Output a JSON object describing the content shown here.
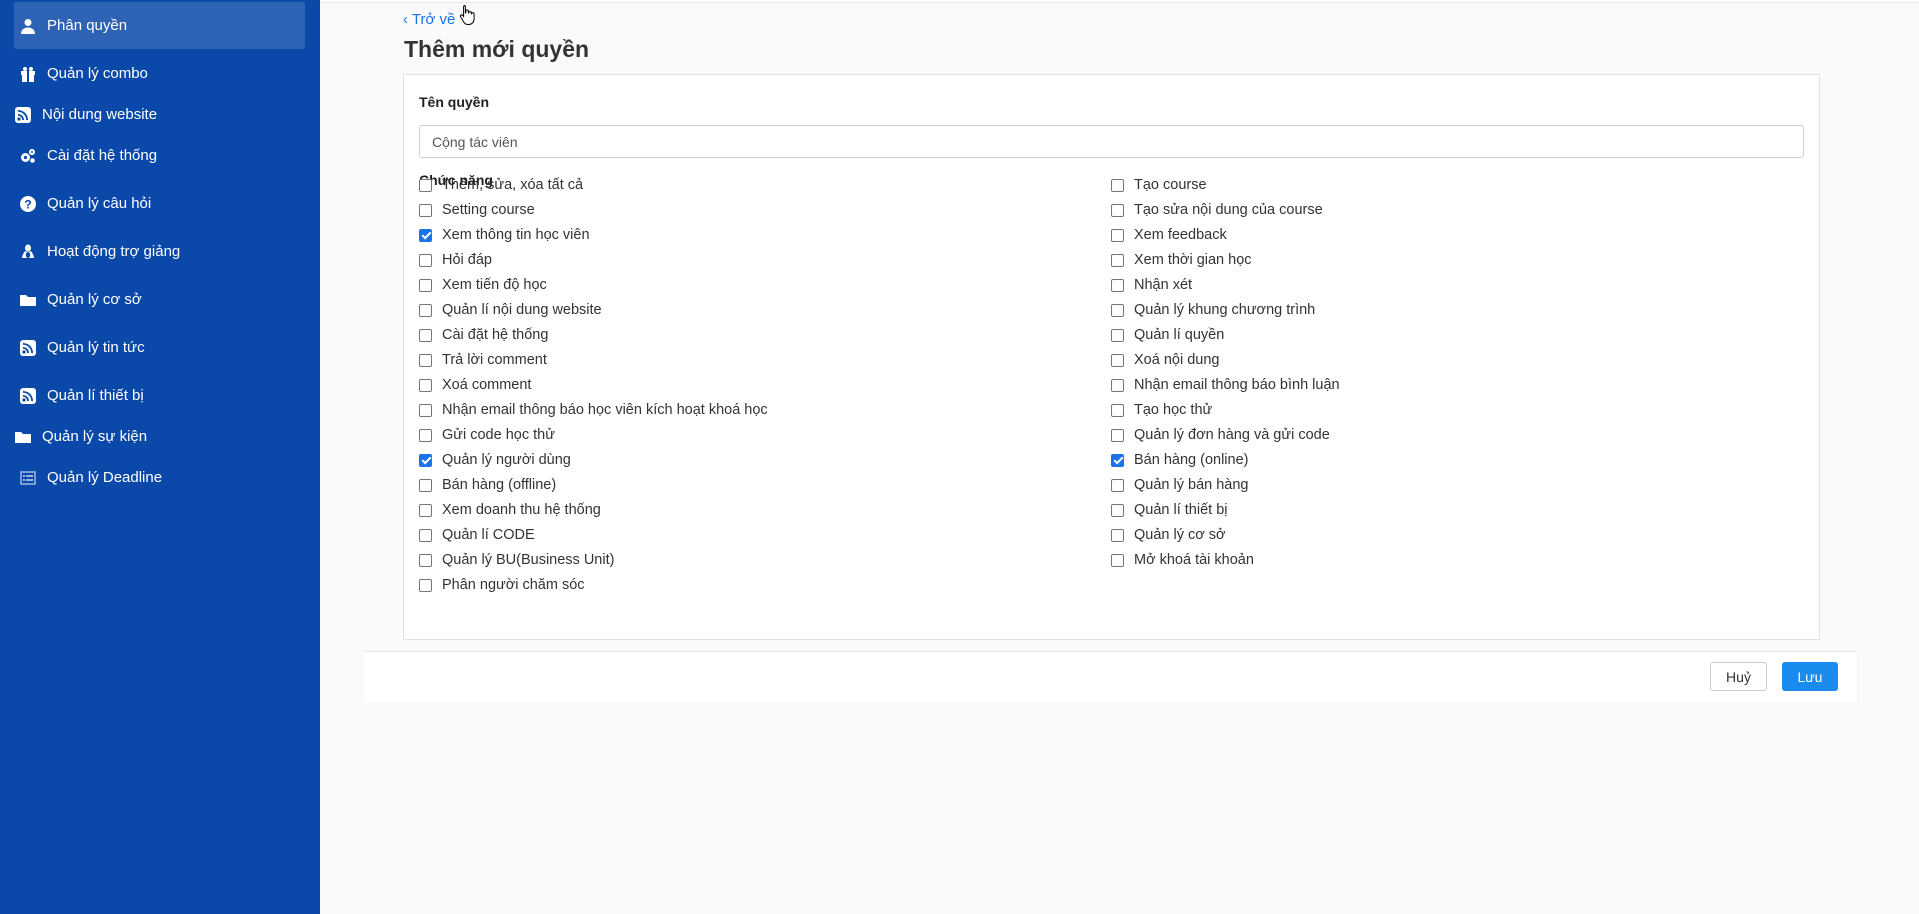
{
  "sidebar": {
    "items": [
      {
        "label": "Phân quyền",
        "icon": "user-icon",
        "active": true
      },
      {
        "label": "Quản lý combo",
        "icon": "gift-icon"
      },
      {
        "label": "Nội dung website",
        "icon": "rss-icon"
      },
      {
        "label": "Cài đặt hệ thống",
        "icon": "gears-icon"
      },
      {
        "label": "Quản lý câu hỏi",
        "icon": "question-icon"
      },
      {
        "label": "Hoạt động trợ giảng",
        "icon": "linux-icon"
      },
      {
        "label": "Quản lý cơ sở",
        "icon": "folder-icon"
      },
      {
        "label": "Quản lý tin tức",
        "icon": "rss-icon"
      },
      {
        "label": "Quản lí thiết bị",
        "icon": "rss-icon"
      },
      {
        "label": "Quản lý sự kiện",
        "icon": "folder-icon"
      },
      {
        "label": "Quản lý Deadline",
        "icon": "list-icon"
      }
    ]
  },
  "header": {
    "back_label": "‹ Trở về",
    "title": "Thêm mới quyền"
  },
  "form": {
    "name_label": "Tên quyền",
    "name_value": "Cộng tác viên",
    "functions_label": "Chức năng"
  },
  "permissions_left": [
    {
      "label": "Thêm, sửa, xóa tất cả",
      "checked": false
    },
    {
      "label": "Setting course",
      "checked": false
    },
    {
      "label": "Xem thông tin học viên",
      "checked": true
    },
    {
      "label": "Hỏi đáp",
      "checked": false
    },
    {
      "label": "Xem tiến độ học",
      "checked": false
    },
    {
      "label": "Quản lí nội dung website",
      "checked": false
    },
    {
      "label": "Cài đặt hệ thống",
      "checked": false
    },
    {
      "label": "Trả lời comment",
      "checked": false
    },
    {
      "label": "Xoá comment",
      "checked": false
    },
    {
      "label": "Nhận email thông báo học viên kích hoạt khoá học",
      "checked": false
    },
    {
      "label": "Gửi code học thử",
      "checked": false
    },
    {
      "label": "Quản lý người dùng",
      "checked": true
    },
    {
      "label": "Bán hàng (offline)",
      "checked": false
    },
    {
      "label": "Xem doanh thu hệ thống",
      "checked": false
    },
    {
      "label": "Quản lí CODE",
      "checked": false
    },
    {
      "label": "Quản lý BU(Business Unit)",
      "checked": false
    },
    {
      "label": "Phân người chăm sóc",
      "checked": false
    }
  ],
  "permissions_right": [
    {
      "label": "Tạo course",
      "checked": false
    },
    {
      "label": "Tạo sửa nội dung của course",
      "checked": false
    },
    {
      "label": "Xem feedback",
      "checked": false
    },
    {
      "label": "Xem thời gian học",
      "checked": false
    },
    {
      "label": "Nhận xét",
      "checked": false
    },
    {
      "label": "Quản lý khung chương trình",
      "checked": false
    },
    {
      "label": "Quản lí quyền",
      "checked": false
    },
    {
      "label": "Xoá nội dung",
      "checked": false
    },
    {
      "label": "Nhận email thông báo bình luận",
      "checked": false
    },
    {
      "label": "Tạo học thử",
      "checked": false
    },
    {
      "label": "Quản lý đơn hàng và gửi code",
      "checked": false
    },
    {
      "label": "Bán hàng (online)",
      "checked": true
    },
    {
      "label": "Quản lý bán hàng",
      "checked": false
    },
    {
      "label": "Quản lí thiết bị",
      "checked": false
    },
    {
      "label": "Quản lý cơ sở",
      "checked": false
    },
    {
      "label": "Mở khoá tài khoản",
      "checked": false
    }
  ],
  "footer": {
    "cancel_label": "Huỷ",
    "save_label": "Lưu"
  },
  "colors": {
    "sidebar_bg": "#0a49aa",
    "accent": "#1a73e8",
    "save_button": "#1a8cf0"
  }
}
